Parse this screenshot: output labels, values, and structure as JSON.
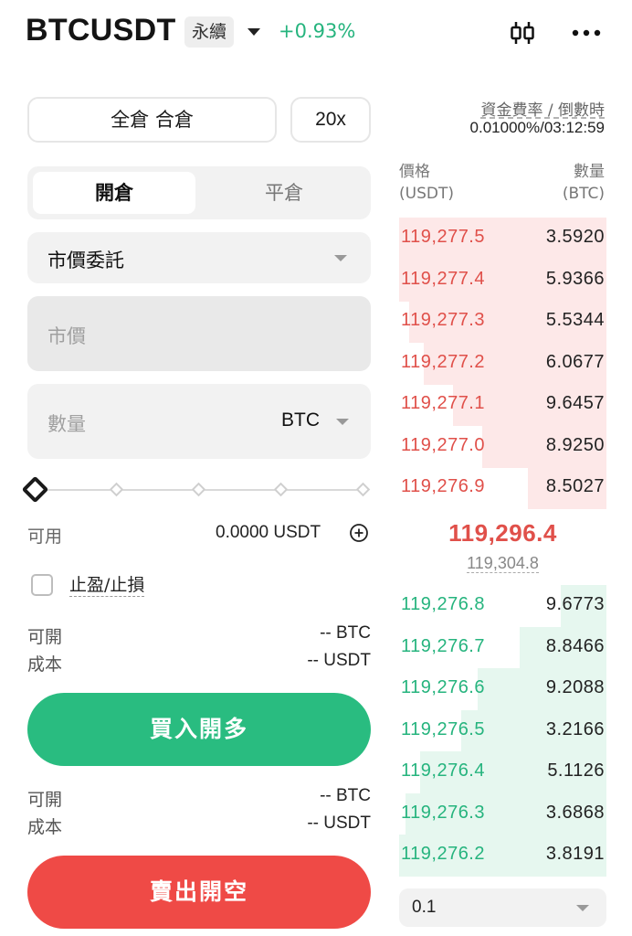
{
  "header": {
    "symbol": "BTCUSDT",
    "contract_type": "永續",
    "change": "+0.93%",
    "icons": [
      "caret-down-icon",
      "candlestick-chart-icon",
      "more-icon"
    ]
  },
  "order_form": {
    "margin_mode": "全倉 合倉",
    "leverage": "20x",
    "tabs": {
      "open": "開倉",
      "close": "平倉"
    },
    "order_type": "市價委託",
    "price_placeholder": "市價",
    "qty_placeholder": "數量",
    "qty_unit": "BTC",
    "slider_percent": 0,
    "available_label": "可用",
    "available_value": "0.0000 USDT",
    "tpsl_label": "止盈/止損",
    "buy_info": {
      "open_label": "可開",
      "open_value": "-- BTC",
      "cost_label": "成本",
      "cost_value": "-- USDT"
    },
    "buy_button": "買入開多",
    "sell_info": {
      "open_label": "可開",
      "open_value": "-- BTC",
      "cost_label": "成本",
      "cost_value": "-- USDT"
    },
    "sell_button": "賣出開空"
  },
  "funding": {
    "label": "資金費率 / 倒數時",
    "value": "0.01000%/03:12:59"
  },
  "orderbook": {
    "price_header": "價格",
    "price_unit": "(USDT)",
    "qty_header": "數量",
    "qty_unit": "(BTC)",
    "asks": [
      {
        "price": "119,277.5",
        "qty": "3.5920",
        "depth": 1.0
      },
      {
        "price": "119,277.4",
        "qty": "5.9366",
        "depth": 1.0
      },
      {
        "price": "119,277.3",
        "qty": "5.5344",
        "depth": 0.95
      },
      {
        "price": "119,277.2",
        "qty": "6.0677",
        "depth": 0.88
      },
      {
        "price": "119,277.1",
        "qty": "9.6457",
        "depth": 0.74
      },
      {
        "price": "119,277.0",
        "qty": "8.9250",
        "depth": 0.6
      },
      {
        "price": "119,276.9",
        "qty": "8.5027",
        "depth": 0.38
      }
    ],
    "last_price": "119,296.4",
    "mark_price": "119,304.8",
    "bids": [
      {
        "price": "119,276.8",
        "qty": "9.6773",
        "depth": 0.22
      },
      {
        "price": "119,276.7",
        "qty": "8.8466",
        "depth": 0.42
      },
      {
        "price": "119,276.6",
        "qty": "9.2088",
        "depth": 0.62
      },
      {
        "price": "119,276.5",
        "qty": "3.2166",
        "depth": 0.7
      },
      {
        "price": "119,276.4",
        "qty": "5.1126",
        "depth": 0.9
      },
      {
        "price": "119,276.3",
        "qty": "3.6868",
        "depth": 0.97
      },
      {
        "price": "119,276.2",
        "qty": "3.8191",
        "depth": 1.0
      }
    ],
    "depth_step": "0.1"
  }
}
